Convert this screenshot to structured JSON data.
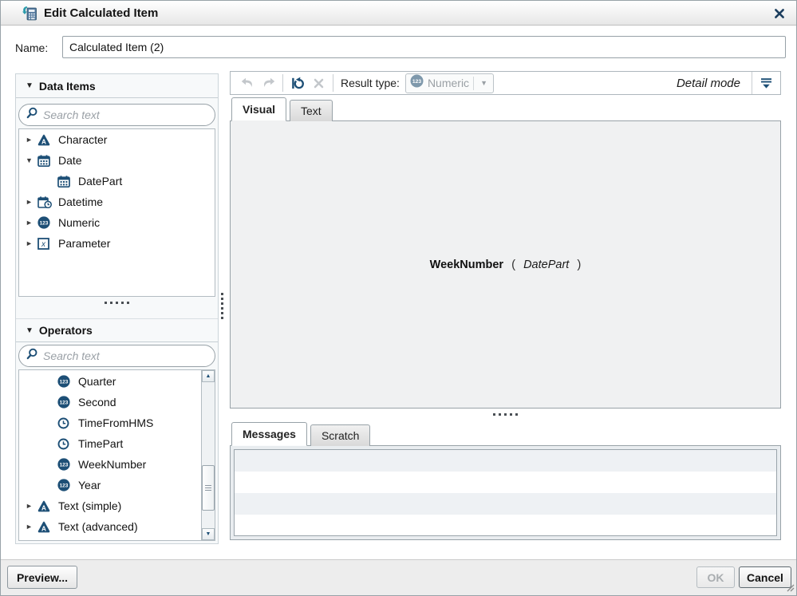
{
  "colors": {
    "accent_navy": "#1d4f76",
    "disabled_icon_gray": "#c3c7cb",
    "canvas_bg": "#f0f1f2",
    "teal_accent": "#2a9bab"
  },
  "titlebar": {
    "title": "Edit Calculated Item"
  },
  "name_field": {
    "label": "Name:",
    "value": "Calculated Item (2)"
  },
  "data_items": {
    "header": "Data Items",
    "search_placeholder": "Search text",
    "tree": [
      {
        "label": "Character",
        "state": "collapsed"
      },
      {
        "label": "Date",
        "state": "expanded"
      },
      {
        "label": "DatePart",
        "state": "leaf-child"
      },
      {
        "label": "Datetime",
        "state": "collapsed"
      },
      {
        "label": "Numeric",
        "state": "collapsed"
      },
      {
        "label": "Parameter",
        "state": "collapsed"
      }
    ]
  },
  "operators": {
    "header": "Operators",
    "search_placeholder": "Search text",
    "items": [
      {
        "label": "Quarter"
      },
      {
        "label": "Second"
      },
      {
        "label": "TimeFromHMS"
      },
      {
        "label": "TimePart"
      },
      {
        "label": "WeekNumber"
      },
      {
        "label": "Year"
      },
      {
        "label": "Text (simple)",
        "state": "collapsed"
      },
      {
        "label": "Text (advanced)",
        "state": "collapsed"
      }
    ]
  },
  "toolbar": {
    "result_type_label": "Result type:",
    "result_type_value": "Numeric",
    "detail_mode_label": "Detail mode"
  },
  "editor_tabs": {
    "visual": "Visual",
    "text": "Text"
  },
  "expression": {
    "function": "WeekNumber",
    "open_paren": "(",
    "argument": "DatePart",
    "close_paren": ")"
  },
  "bottom_tabs": {
    "messages": "Messages",
    "scratch": "Scratch"
  },
  "footer": {
    "preview": "Preview...",
    "ok": "OK",
    "cancel": "Cancel"
  },
  "icons": {
    "numeric_badge_text": "123",
    "character_badge_text": "A",
    "parameter_badge_text": "x",
    "expand_collapsed": "►",
    "expand_expanded": "▼",
    "section_collapse": "▼",
    "scroll_up": "▲",
    "scroll_down": "▼",
    "dropdown_arrow": "▼"
  }
}
